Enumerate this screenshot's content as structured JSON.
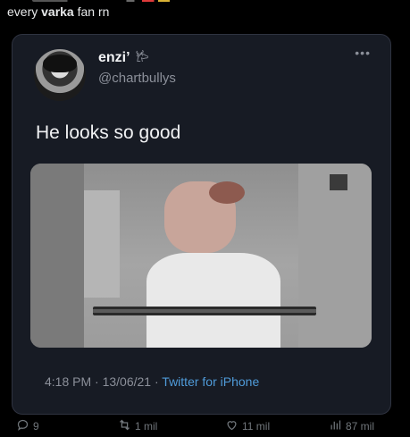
{
  "caption": {
    "prefix": "every ",
    "bold": "varka",
    "suffix": " fan rn"
  },
  "embedded_tweet": {
    "name": "enzi’",
    "name_badge": "𐂂",
    "handle": "@chartbullys",
    "text": "He looks so good",
    "meta": {
      "time": "4:18 PM",
      "separator1": " · ",
      "date": "13/06/21",
      "separator2": " · ",
      "source": "Twitter for iPhone"
    }
  },
  "actions": {
    "reply_count": "9",
    "retweet_count": "1 mil",
    "like_count": "11 mil",
    "views_count": "87 mil"
  },
  "icons": {
    "more": "more-icon",
    "reply": "reply-icon",
    "retweet": "retweet-icon",
    "like": "heart-icon",
    "views": "views-icon"
  },
  "colors": {
    "background": "#000000",
    "card": "#171b24",
    "link": "#4f9bd9",
    "muted": "#71767b"
  }
}
